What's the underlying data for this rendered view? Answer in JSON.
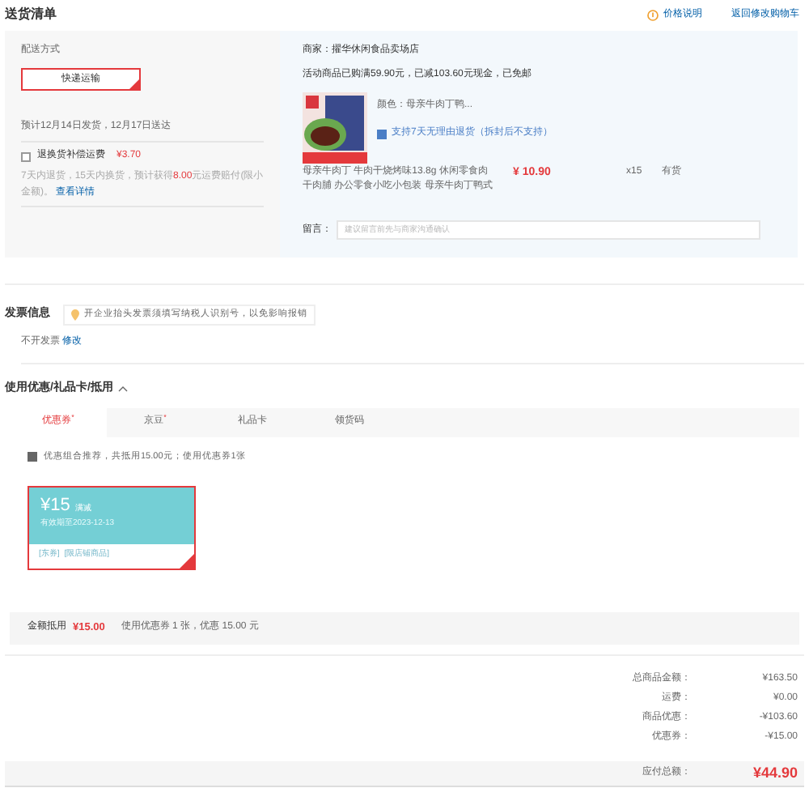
{
  "header": {
    "title": "送货清单",
    "price_note": "价格说明",
    "back_link": "返回修改购物车"
  },
  "shipping": {
    "label": "配送方式",
    "method": {
      "label": "快递运输",
      "selected": true
    },
    "estimate": "预计12月14日发货，12月17日送达",
    "insurance": {
      "label": "退换货补偿运费",
      "price": "¥3.70",
      "checked": false
    },
    "note_before": "7天内退货，15天内换货，预计获得",
    "note_amount": "8.00",
    "note_after": "元运费赔付(限小金额)。",
    "details_link": "查看详情"
  },
  "store": {
    "merchant": "商家：擢华休闲食品卖场店",
    "promo": "活动商品已购满59.90元，已减103.60元现金，已免邮",
    "item": {
      "variant": "颜色：母亲牛肉丁鸭...",
      "return_policy": "支持7天无理由退货（拆封后不支持）",
      "name": "母亲牛肉丁 牛肉干烧烤味13.8g 休闲零食肉干肉脯 办公零食小吃小包装 母亲牛肉丁鸭式",
      "price": "¥ 10.90",
      "quantity": "x15",
      "stock": "有货"
    },
    "message_label": "留言：",
    "message_placeholder": "建议留言前先与商家沟通确认"
  },
  "invoice": {
    "title": "发票信息",
    "tip": "开企业抬头发票须填写纳税人识别号，以免影响报销",
    "value": "不开发票",
    "edit_link": "修改"
  },
  "discounts": {
    "title": "使用优惠/礼品卡/抵用",
    "expanded": true,
    "tabs": [
      {
        "label": "优惠券",
        "selected": true,
        "mark": "*"
      },
      {
        "label": "京豆",
        "selected": false,
        "mark": "*"
      },
      {
        "label": "礼品卡",
        "selected": false
      },
      {
        "label": "领货码",
        "selected": false
      }
    ],
    "recommend": {
      "label": "优惠组合推荐，共抵用15.00元；使用优惠券1张",
      "checked": true
    },
    "coupon": {
      "amount": "¥15",
      "condition": "满减",
      "validity": "有效期至2023-12-13",
      "type": "[东券]",
      "scope": "[限店铺商品]",
      "selected": true
    },
    "summary_label": "金额抵用",
    "summary_amount": "¥15.00",
    "summary_text": "使用优惠券 1 张，优惠 15.00 元"
  },
  "totals": [
    {
      "label": "总商品金额：",
      "value": "¥163.50"
    },
    {
      "label": "运费：",
      "value": "¥0.00"
    },
    {
      "label": "商品优惠：",
      "value": "-¥103.60"
    },
    {
      "label": "优惠券：",
      "value": "-¥15.00"
    }
  ],
  "payable": {
    "label": "应付总额：",
    "value": "¥44.90"
  }
}
